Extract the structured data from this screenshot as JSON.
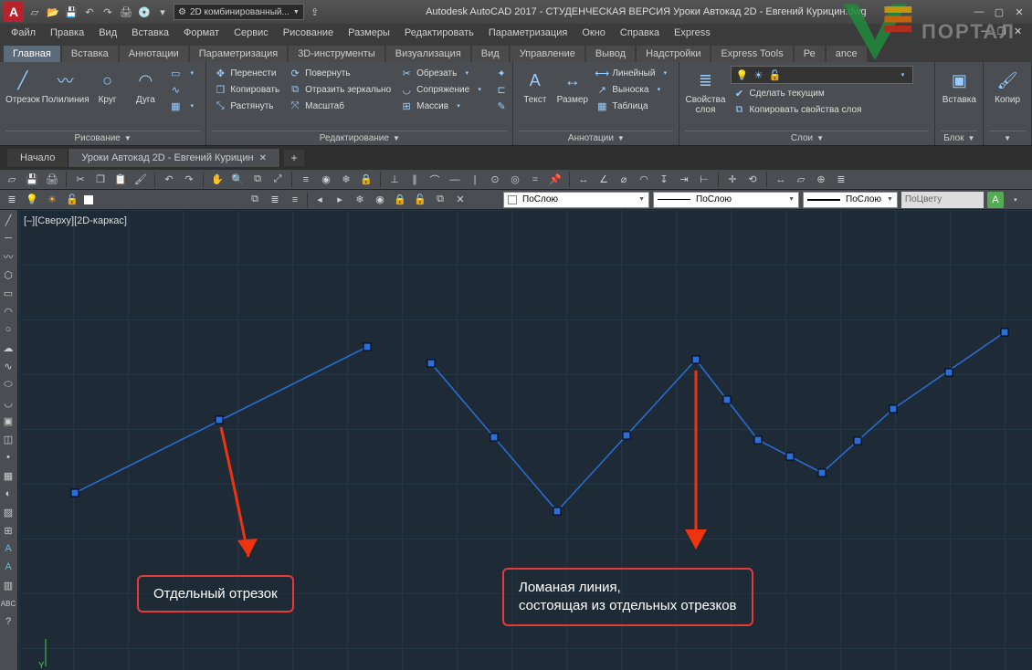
{
  "titlebar": {
    "combo_workspace": "2D комбинированный...",
    "app_title": "Autodesk AutoCAD 2017 - СТУДЕНЧЕСКАЯ ВЕРСИЯ   Уроки Автокад 2D - Евгений Курицин.dwg"
  },
  "menubar": {
    "items": [
      "Файл",
      "Правка",
      "Вид",
      "Вставка",
      "Формат",
      "Сервис",
      "Рисование",
      "Размеры",
      "Редактировать",
      "Параметризация",
      "Окно",
      "Справка",
      "Express"
    ]
  },
  "ribtabs": [
    "Главная",
    "Вставка",
    "Аннотации",
    "Параметризация",
    "3D-инструменты",
    "Визуализация",
    "Вид",
    "Управление",
    "Вывод",
    "Надстройки",
    "Express Tools",
    "Ре",
    "ance"
  ],
  "ribbon": {
    "panel_draw": {
      "title": "Рисование",
      "btns": {
        "line": "Отрезок",
        "polyline": "Полилиния",
        "circle": "Круг",
        "arc": "Дуга"
      }
    },
    "panel_edit": {
      "title": "Редактирование",
      "rows": [
        {
          "icon": "move",
          "label": "Перенести"
        },
        {
          "icon": "copy",
          "label": "Копировать"
        },
        {
          "icon": "stretch",
          "label": "Растянуть"
        }
      ],
      "rows2": [
        {
          "icon": "rotate",
          "label": "Повернуть"
        },
        {
          "icon": "mirror",
          "label": "Отразить зеркально"
        },
        {
          "icon": "scale",
          "label": "Масштаб"
        }
      ],
      "rows3": [
        {
          "icon": "trim",
          "label": "Обрезать"
        },
        {
          "icon": "fillet",
          "label": "Сопряжение"
        },
        {
          "icon": "array",
          "label": "Массив"
        }
      ]
    },
    "panel_anno": {
      "title": "Аннотации",
      "btns": {
        "text": "Текст",
        "dim": "Размер"
      },
      "rows": [
        {
          "icon": "linear",
          "label": "Линейный"
        },
        {
          "icon": "leader",
          "label": "Выноска"
        },
        {
          "icon": "table",
          "label": "Таблица"
        }
      ]
    },
    "panel_layers": {
      "title": "Слои",
      "btn": "Свойства слоя",
      "rows": [
        {
          "label": "Сделать текущим"
        },
        {
          "label": "Копировать свойства слоя"
        }
      ]
    },
    "panel_block": {
      "title": "Блок",
      "btn": "Вставка"
    },
    "panel_props": {
      "title": "",
      "btn": "Копир"
    }
  },
  "doctabs": {
    "start": "Начало",
    "active": "Уроки Автокад 2D - Евгений Курицин"
  },
  "layerbar": {
    "bylayer": "ПоСлою",
    "bylayer2": "ПоСлою",
    "bylayer3": "ПоСлою",
    "bycolor": "ПоЦвету"
  },
  "canvas": {
    "view_label": "[–][Сверху][2D-каркас]",
    "callout1": "Отдельный отрезок",
    "callout2_l1": "Ломаная линия,",
    "callout2_l2": "состоящая из отдельных отрезков",
    "watermark": "ПОРТАЛ"
  },
  "colors": {
    "accent": "#2b6ed6",
    "red": "#e63a3a",
    "canvas": "#1e2b36"
  }
}
